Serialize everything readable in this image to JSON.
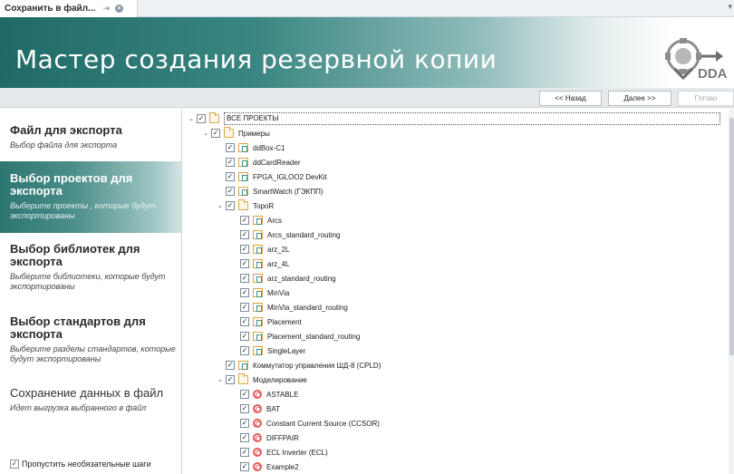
{
  "tab": {
    "title": "Сохранить в файл...",
    "pin": "⇥",
    "close": "×",
    "menu": "▾"
  },
  "banner": {
    "title": "Мастер создания резервной копии",
    "logo_text": "DDA"
  },
  "nav": {
    "back": "<< Назад",
    "next": "Далее >>",
    "done": "Готово"
  },
  "steps": [
    {
      "title": "Файл для экспорта",
      "desc": "Выбор файла для экспорта"
    },
    {
      "title": "Выбор проектов для экспорта",
      "desc": "Выберите проекты , которые будут экспортированы"
    },
    {
      "title": "Выбор библиотек для экспорта",
      "desc": "Выберите библиотеки, которые будут экспортированы"
    },
    {
      "title": "Выбор стандартов для экспорта",
      "desc": "Выберите разделы стандартов, которые будут экспортированы"
    },
    {
      "title": "Сохранение данных в файл",
      "desc": "Идет выгрузка выбранного в файл"
    }
  ],
  "skip_optional": {
    "label": "Пропустить необязательные шаги",
    "checked": true
  },
  "tree": [
    {
      "label": "ВСЕ ПРОЕКТЫ",
      "level": 0,
      "type": "folder",
      "expanded": true,
      "checked": true
    },
    {
      "label": "Примеры",
      "level": 1,
      "type": "folder",
      "expanded": true,
      "checked": true
    },
    {
      "label": "ddBox-C1",
      "level": 2,
      "type": "project",
      "checked": true
    },
    {
      "label": "ddCardReader",
      "level": 2,
      "type": "project",
      "checked": true
    },
    {
      "label": "FPGA_IGLOO2 DevKit",
      "level": 2,
      "type": "project",
      "checked": true
    },
    {
      "label": "SmartWatch (ГЭКПП)",
      "level": 2,
      "type": "project",
      "checked": true
    },
    {
      "label": "TopoR",
      "level": 2,
      "type": "folder",
      "expanded": true,
      "checked": true
    },
    {
      "label": "Arcs",
      "level": 3,
      "type": "project",
      "checked": true
    },
    {
      "label": "Arcs_standard_routing",
      "level": 3,
      "type": "project",
      "checked": true
    },
    {
      "label": "arz_2L",
      "level": 3,
      "type": "project",
      "checked": true
    },
    {
      "label": "arz_4L",
      "level": 3,
      "type": "project",
      "checked": true
    },
    {
      "label": "arz_standard_routing",
      "level": 3,
      "type": "project",
      "checked": true
    },
    {
      "label": "MinVia",
      "level": 3,
      "type": "project",
      "checked": true
    },
    {
      "label": "MinVia_standard_routing",
      "level": 3,
      "type": "project",
      "checked": true
    },
    {
      "label": "Placement",
      "level": 3,
      "type": "project",
      "checked": true
    },
    {
      "label": "Placement_standard_routing",
      "level": 3,
      "type": "project",
      "checked": true
    },
    {
      "label": "SingleLayer",
      "level": 3,
      "type": "project",
      "checked": true
    },
    {
      "label": "Коммутатор управления ШД-8 (CPLD)",
      "level": 2,
      "type": "project",
      "checked": true
    },
    {
      "label": "Моделирование",
      "level": 2,
      "type": "folder",
      "expanded": true,
      "checked": true
    },
    {
      "label": "ASTABLE",
      "level": 3,
      "type": "sim",
      "checked": true
    },
    {
      "label": "BAT",
      "level": 3,
      "type": "sim",
      "checked": true
    },
    {
      "label": "Constant Current Source (CCSOR)",
      "level": 3,
      "type": "sim",
      "checked": true
    },
    {
      "label": "DIFFPAIR",
      "level": 3,
      "type": "sim",
      "checked": true
    },
    {
      "label": "ECL Inverter (ECL)",
      "level": 3,
      "type": "sim",
      "checked": true
    },
    {
      "label": "Example2",
      "level": 3,
      "type": "sim",
      "checked": true
    }
  ],
  "symbols": {
    "check": "✓",
    "expanded": "⌄"
  },
  "colors": {
    "accent": "#2d7571",
    "banner_start": "#1f6a66"
  }
}
